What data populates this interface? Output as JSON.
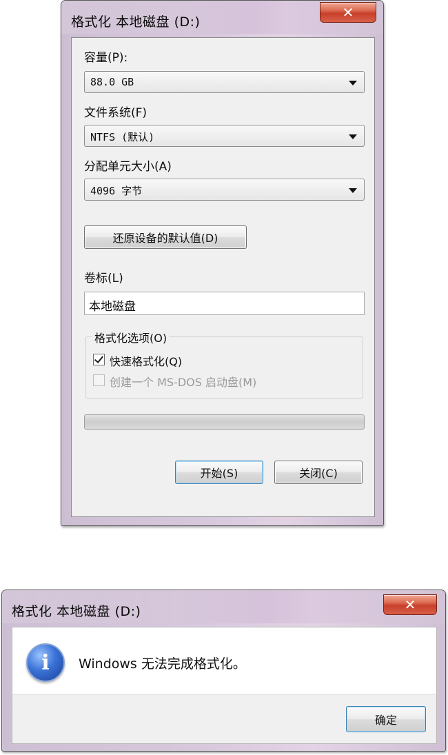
{
  "format_dialog": {
    "title": "格式化 本地磁盘 (D:)",
    "close_symbol": "✕",
    "capacity": {
      "label": "容量(P):",
      "value": "88.0 GB"
    },
    "file_system": {
      "label": "文件系统(F)",
      "value": "NTFS (默认)"
    },
    "allocation": {
      "label": "分配单元大小(A)",
      "value": "4096 字节"
    },
    "restore_defaults_label": "还原设备的默认值(D)",
    "volume_label": {
      "label": "卷标(L)",
      "value": "本地磁盘"
    },
    "options": {
      "title": "格式化选项(O)",
      "quick_format": {
        "label": "快速格式化(Q)",
        "checked": true
      },
      "msdos_boot": {
        "label": "创建一个 MS-DOS 启动盘(M)",
        "checked": false,
        "enabled": false
      }
    },
    "progress": 0,
    "start_label": "开始(S)",
    "close_label": "关闭(C)"
  },
  "message_box": {
    "title": "格式化 本地磁盘 (D:)",
    "close_symbol": "✕",
    "icon": "info-icon",
    "icon_glyph": "i",
    "message": "Windows 无法完成格式化。",
    "ok_label": "确定"
  }
}
